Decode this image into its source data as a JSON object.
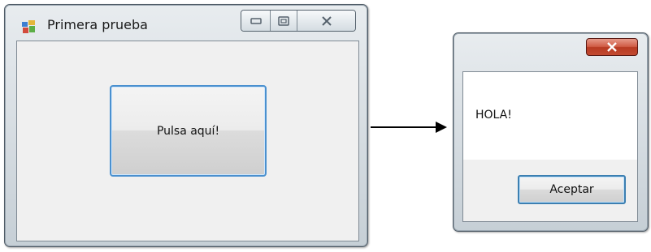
{
  "main_window": {
    "title": "Primera prueba",
    "app_icon": "winforms-app-icon",
    "caption_buttons": {
      "minimize_icon": "minimize-icon",
      "maximize_icon": "maximize-icon",
      "close_icon": "close-icon"
    },
    "button_label": "Pulsa aquí!"
  },
  "arrow": "right-arrow",
  "message_box": {
    "close_icon": "close-icon",
    "message": "HOLA!",
    "ok_label": "Aceptar"
  },
  "colors": {
    "frame": "#c6cfd6",
    "client": "#f0f0f0",
    "focus_border": "#4a90cf",
    "close_red": "#c24a31"
  }
}
